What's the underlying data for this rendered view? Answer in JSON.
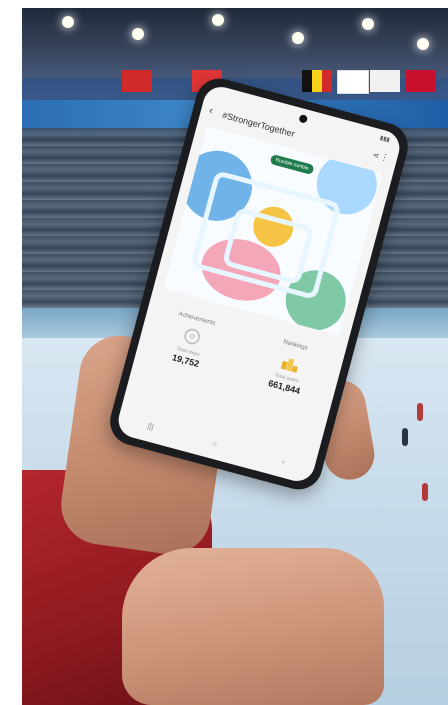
{
  "phone": {
    "app_title": "#StrongerTogether",
    "status_time": "",
    "art_tag": "Rumble rumble",
    "stats": [
      {
        "label": "Achievements",
        "sub": "Total steps",
        "value": "19,752"
      },
      {
        "label": "Rankings",
        "sub": "Total users",
        "value": "661,844"
      }
    ],
    "icons": {
      "back": "back-arrow-icon",
      "share": "share-icon",
      "more": "more-icon",
      "achievements": "medal-icon",
      "rankings": "podium-icon",
      "nav_recent": "recent-apps-icon",
      "nav_home": "home-icon",
      "nav_back": "nav-back-icon"
    }
  },
  "colors": {
    "sleeve": "#b3262c",
    "podium": "#e8b12a",
    "banner": "#2c6db3"
  }
}
